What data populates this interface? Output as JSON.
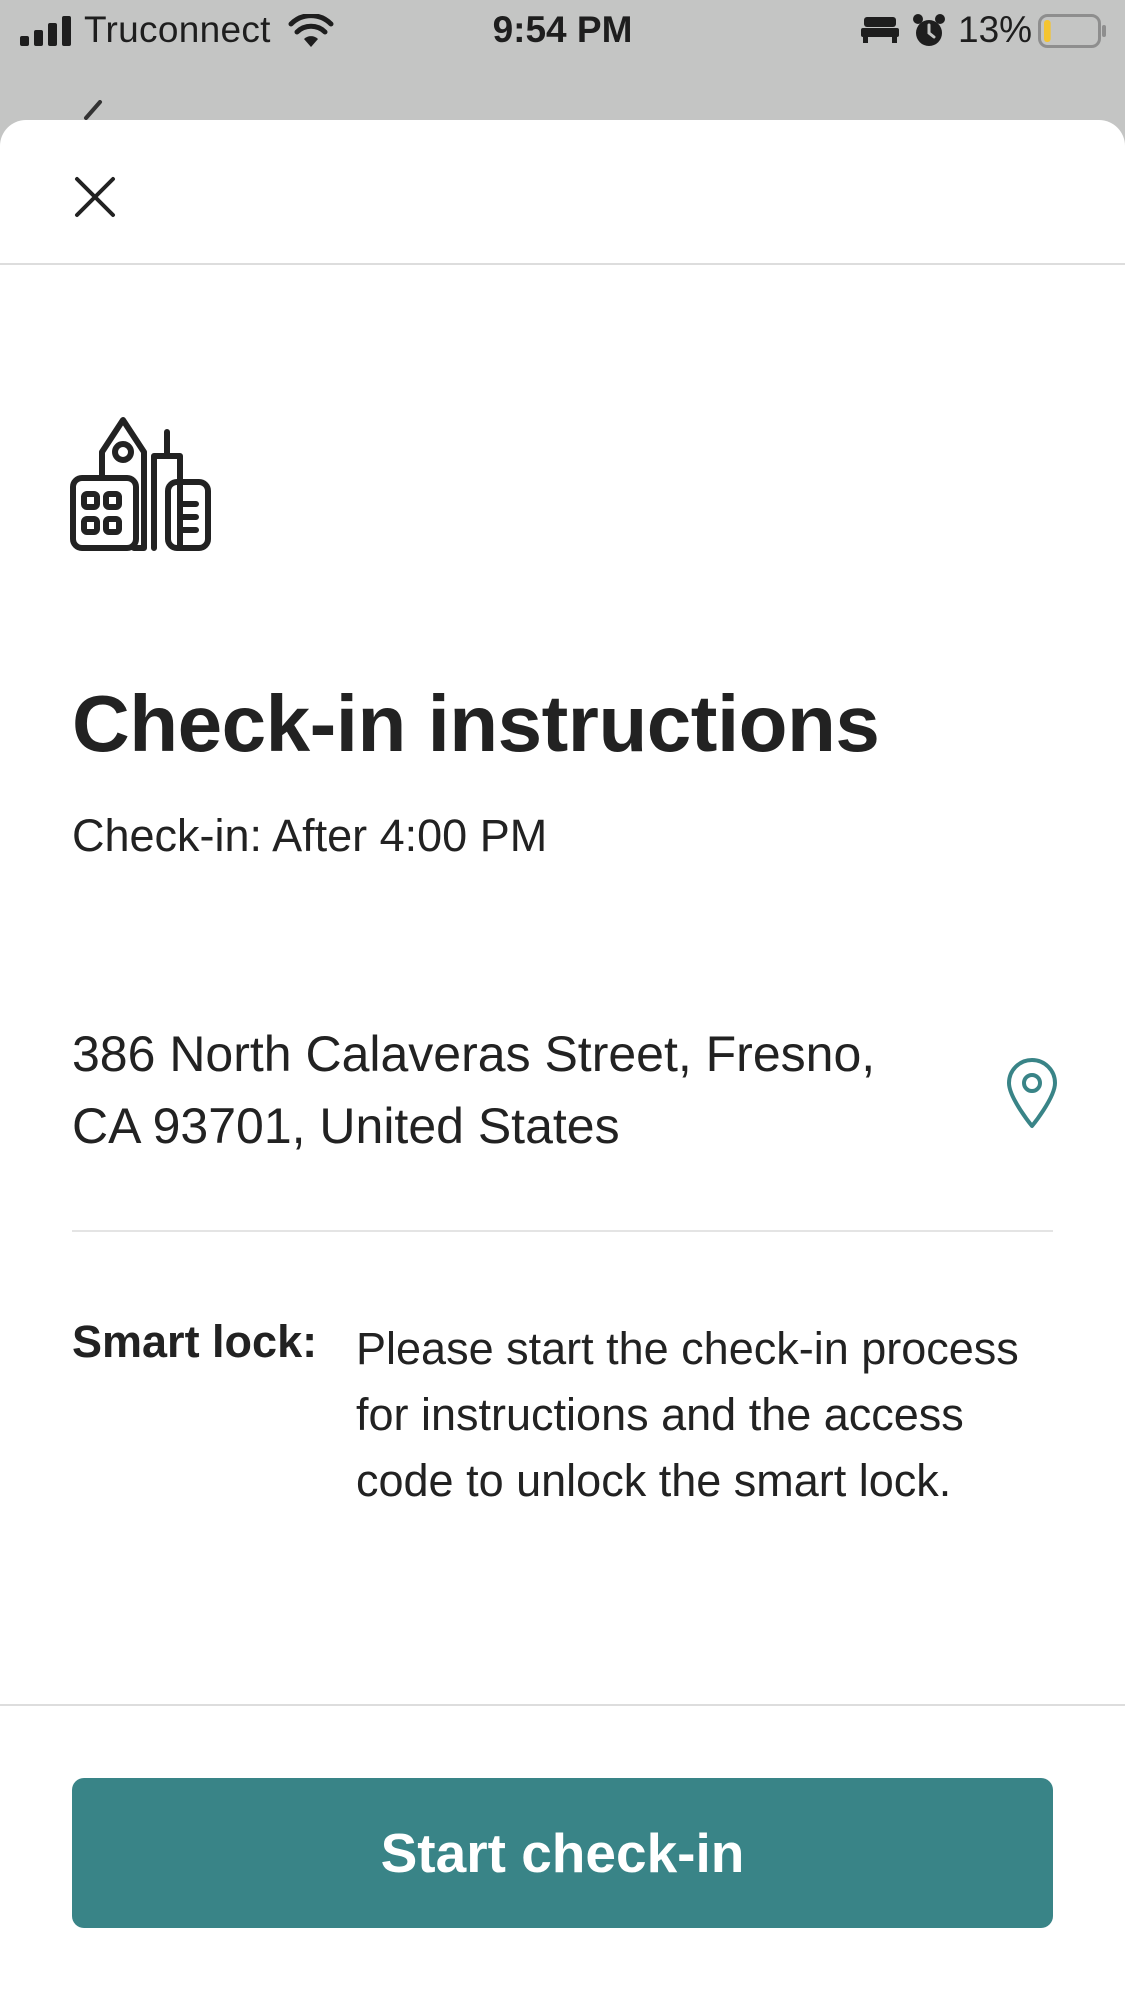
{
  "status_bar": {
    "carrier": "Truconnect",
    "time": "9:54 PM",
    "battery_percent": "13%",
    "battery_level": 0.13,
    "icons": [
      "signal-icon",
      "wifi-icon",
      "bed-icon",
      "alarm-icon",
      "battery-icon"
    ]
  },
  "sheet": {
    "close_icon": "close-icon",
    "hero_icon": "buildings-icon",
    "title": "Check-in instructions",
    "checkin_time": "Check-in: After 4:00 PM",
    "address_line1": "386 North Calaveras Street, Fresno,",
    "address_line2": "CA 93701, United States",
    "map_icon": "map-pin-icon",
    "smart_lock_label": "Smart lock:",
    "smart_lock_text": "Please start the check-in process for instructions and the access code to unlock the smart lock.",
    "primary_button": "Start check-in"
  },
  "colors": {
    "accent": "#398487",
    "text": "#222222",
    "status_bar_bg": "#c4c5c4"
  }
}
